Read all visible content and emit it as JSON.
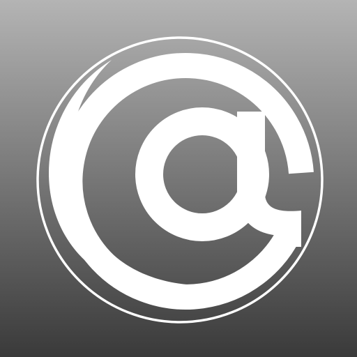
{
  "icon": {
    "name": "at-sign-icon",
    "colors": {
      "background_top": "#b4b4b4",
      "background_bottom": "#3a3a3a",
      "glyph": "#ffffff"
    }
  }
}
